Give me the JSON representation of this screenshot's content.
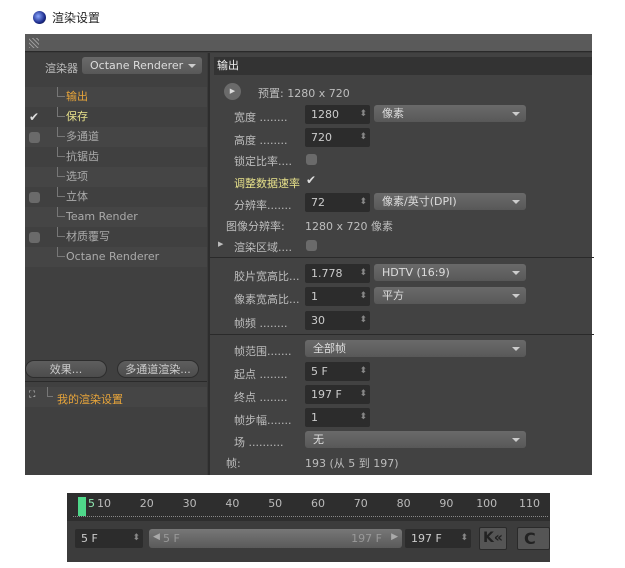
{
  "window": {
    "title": "渲染设置"
  },
  "left": {
    "renderer_label": "渲染器",
    "renderer_value": "Octane Renderer",
    "tree": [
      {
        "label": "输出",
        "checkbox": "none",
        "color": "#e8a53a"
      },
      {
        "label": "保存",
        "checkbox": "checked",
        "color": "#e6e08a"
      },
      {
        "label": "多通道",
        "checkbox": "unchecked",
        "color": "#aaaaaa"
      },
      {
        "label": "抗锯齿",
        "checkbox": "none",
        "color": "#aaaaaa"
      },
      {
        "label": "选项",
        "checkbox": "none",
        "color": "#aaaaaa"
      },
      {
        "label": "立体",
        "checkbox": "unchecked",
        "color": "#aaaaaa"
      },
      {
        "label": "Team Render",
        "checkbox": "none",
        "color": "#aaaaaa"
      },
      {
        "label": "材质覆写",
        "checkbox": "unchecked",
        "color": "#aaaaaa"
      },
      {
        "label": "Octane Renderer",
        "checkbox": "none",
        "color": "#aaaaaa"
      }
    ],
    "effects_button": "效果...",
    "multipass_button": "多通道渲染...",
    "preset_name": "我的渲染设置"
  },
  "output": {
    "header": "输出",
    "preset": "预置: 1280 x 720",
    "width_label": "宽度 ........",
    "width": "1280",
    "unit": "像素",
    "height_label": "高度 ........",
    "height": "720",
    "lock_label": "锁定比率....",
    "adjust_label": "调整数据速率",
    "res_label": "分辨率.......",
    "res": "72",
    "res_unit": "像素/英寸(DPI)",
    "imgres_label": "图像分辨率:",
    "imgres": "1280 x 720 像素",
    "region_label": "渲染区域....",
    "film_label": "胶片宽高比...",
    "film": "1.778",
    "film_preset": "HDTV (16:9)",
    "pixel_label": "像素宽高比...",
    "pixel": "1",
    "pixel_preset": "平方",
    "fps_label": "帧频 ........",
    "fps": "30",
    "range_label": "帧范围.......",
    "range": "全部帧",
    "start_label": "起点 ........",
    "start": "5 F",
    "end_label": "终点 ........",
    "end": "197 F",
    "step_label": "帧步幅.......",
    "step": "1",
    "field_label": "场 ..........",
    "field": "无",
    "frames_label": "帧:",
    "frames": "193 (从 5 到 197)"
  },
  "timeline": {
    "current": "5",
    "ticks": [
      "10",
      "20",
      "30",
      "40",
      "50",
      "60",
      "70",
      "80",
      "90",
      "100",
      "110"
    ],
    "start_field": "5 F",
    "slider_start": "5 F",
    "slider_end": "197 F",
    "end_field": "197 F"
  }
}
